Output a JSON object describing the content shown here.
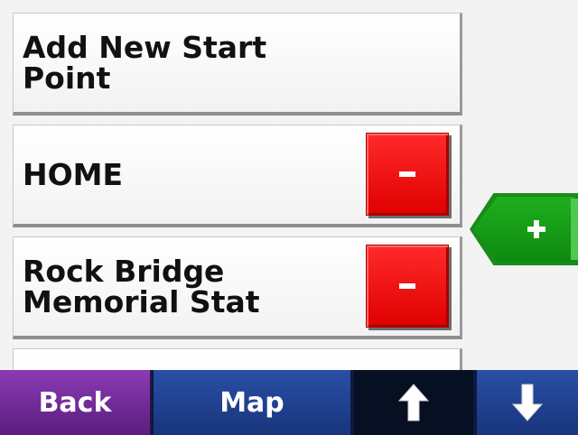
{
  "list": {
    "items": [
      {
        "label": "Add New Start Point",
        "has_remove": false
      },
      {
        "label": "HOME",
        "has_remove": true,
        "remove_label": "-"
      },
      {
        "label": "Rock Bridge\nMemorial Stat",
        "has_remove": true,
        "remove_label": "-"
      }
    ]
  },
  "add_button": {
    "label": "+"
  },
  "bottom_bar": {
    "back_label": "Back",
    "map_label": "Map",
    "up_icon": "arrow-up-icon",
    "down_icon": "arrow-down-icon"
  },
  "colors": {
    "remove": "#e60000",
    "add": "#1a9a1a",
    "back": "#6b2a8f",
    "nav": "#1d3a8a"
  }
}
